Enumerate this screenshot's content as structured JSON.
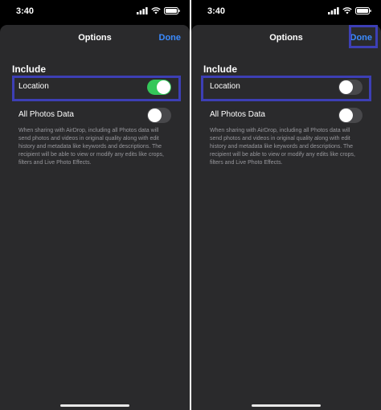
{
  "status_bar": {
    "time": "3:40"
  },
  "nav": {
    "title": "Options",
    "done_label": "Done"
  },
  "section_header": "Include",
  "rows": {
    "location": {
      "label": "Location"
    },
    "all_photos": {
      "label": "All Photos Data"
    }
  },
  "description": "When sharing with AirDrop, including all Photos data will send photos and videos in original quality along with edit history and metadata like keywords and descriptions. The recipient will be able to view or modify any edits like crops, filters and Live Photo Effects.",
  "screens": [
    {
      "location_toggle_on": true,
      "all_photos_toggle_on": false
    },
    {
      "location_toggle_on": false,
      "all_photos_toggle_on": false
    }
  ],
  "colors": {
    "accent": "#3b8bff",
    "toggle_on": "#34c759",
    "toggle_off": "#48484b",
    "highlight": "#3d3fb5",
    "sheet_bg": "#2a2a2c"
  },
  "icons": [
    "signal-icon",
    "wifi-icon",
    "battery-icon"
  ]
}
